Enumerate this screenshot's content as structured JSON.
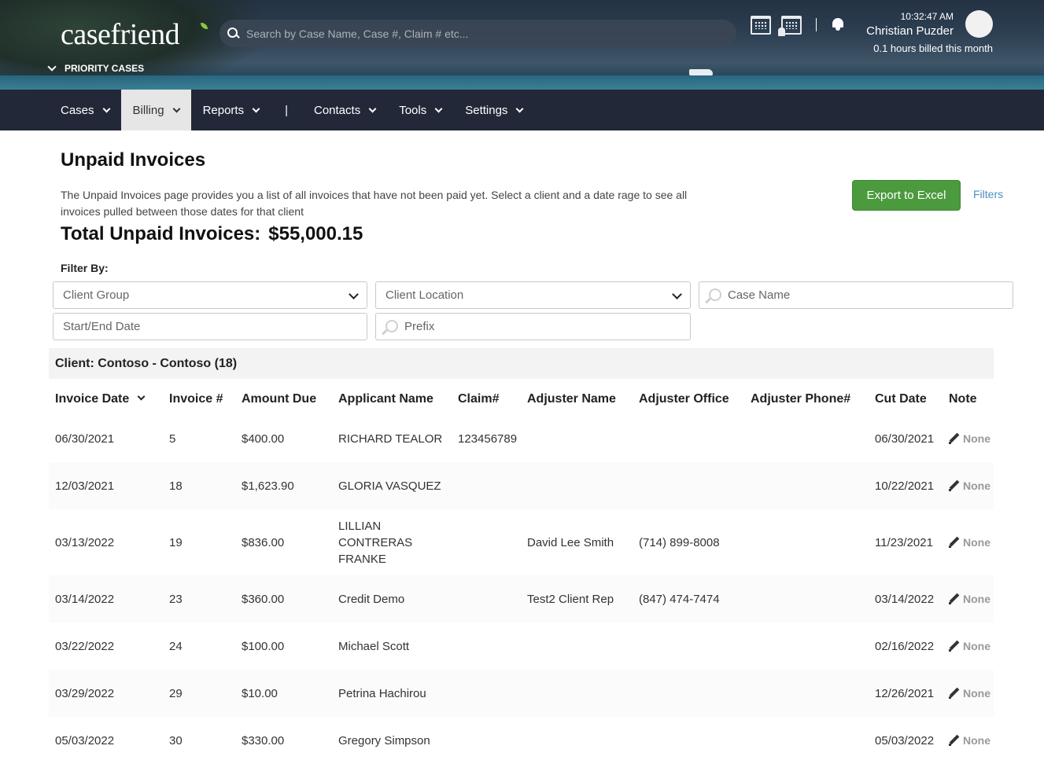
{
  "header": {
    "logo": "casefriend",
    "priority_cases": "PRIORITY CASES",
    "search_placeholder": "Search by Case Name, Case #, Claim # etc...",
    "time": "10:32:47 AM",
    "user_name": "Christian Puzder",
    "billed": "0.1 hours billed this month"
  },
  "nav": {
    "items": [
      {
        "label": "Cases"
      },
      {
        "label": "Billing"
      },
      {
        "label": "Reports"
      },
      {
        "label": "|"
      },
      {
        "label": "Contacts"
      },
      {
        "label": "Tools"
      },
      {
        "label": "Settings"
      }
    ],
    "active": "Billing"
  },
  "page": {
    "title": "Unpaid Invoices",
    "description": "The Unpaid Invoices page provides you a list of all invoices that have not been paid yet. Select a client and a date rage to see all invoices pulled between those dates for that client",
    "total_label": "Total Unpaid Invoices:",
    "total_value": "$55,000.15",
    "export_label": "Export to Excel",
    "filters_label": "Filters"
  },
  "filters": {
    "label": "Filter By:",
    "client_group": "Client Group",
    "client_location": "Client Location",
    "case_name": "Case Name",
    "date_range": "Start/End Date",
    "prefix": "Prefix"
  },
  "client": {
    "label": "Client: Contoso - Contoso (18)"
  },
  "table": {
    "columns": [
      "Invoice Date",
      "Invoice #",
      "Amount Due",
      "Applicant Name",
      "Claim#",
      "Adjuster Name",
      "Adjuster Office",
      "Adjuster Phone#",
      "Cut Date",
      "Note"
    ],
    "rows": [
      {
        "date": "06/30/2021",
        "invoice": "5",
        "amount": "$400.00",
        "applicant": "RICHARD TEALOR",
        "claim": "123456789",
        "adjuster": "",
        "office": "",
        "phone": "",
        "cut": "06/30/2021",
        "note": "None"
      },
      {
        "date": "12/03/2021",
        "invoice": "18",
        "amount": "$1,623.90",
        "applicant": "GLORIA VASQUEZ",
        "claim": "",
        "adjuster": "",
        "office": "",
        "phone": "",
        "cut": "10/22/2021",
        "note": "None"
      },
      {
        "date": "03/13/2022",
        "invoice": "19",
        "amount": "$836.00",
        "applicant": "LILLIAN CONTRERAS FRANKE",
        "claim": "",
        "adjuster": "David Lee Smith",
        "office": "(714) 899-8008",
        "phone": "",
        "cut": "11/23/2021",
        "note": "None"
      },
      {
        "date": "03/14/2022",
        "invoice": "23",
        "amount": "$360.00",
        "applicant": "Credit Demo",
        "claim": "",
        "adjuster": "Test2 Client Rep",
        "office": "(847) 474-7474",
        "phone": "",
        "cut": "03/14/2022",
        "note": "None"
      },
      {
        "date": "03/22/2022",
        "invoice": "24",
        "amount": "$100.00",
        "applicant": "Michael Scott",
        "claim": "",
        "adjuster": "",
        "office": "",
        "phone": "",
        "cut": "02/16/2022",
        "note": "None"
      },
      {
        "date": "03/29/2022",
        "invoice": "29",
        "amount": "$10.00",
        "applicant": "Petrina Hachirou",
        "claim": "",
        "adjuster": "",
        "office": "",
        "phone": "",
        "cut": "12/26/2021",
        "note": "None"
      },
      {
        "date": "05/03/2022",
        "invoice": "30",
        "amount": "$330.00",
        "applicant": "Gregory Simpson",
        "claim": "",
        "adjuster": "",
        "office": "",
        "phone": "",
        "cut": "05/03/2022",
        "note": "None"
      }
    ]
  }
}
